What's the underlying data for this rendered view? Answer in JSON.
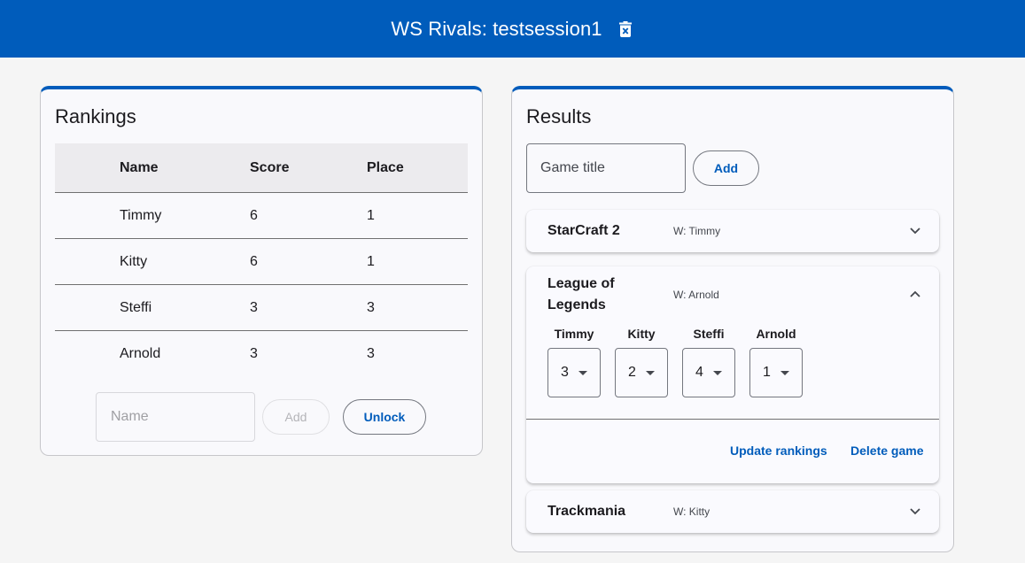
{
  "header": {
    "title": "WS Rivals: testsession1"
  },
  "rankings": {
    "title": "Rankings",
    "columns": [
      "Name",
      "Score",
      "Place"
    ],
    "rows": [
      {
        "name": "Timmy",
        "score": "6",
        "place": "1"
      },
      {
        "name": "Kitty",
        "score": "6",
        "place": "1"
      },
      {
        "name": "Steffi",
        "score": "3",
        "place": "3"
      },
      {
        "name": "Arnold",
        "score": "3",
        "place": "3"
      }
    ],
    "name_placeholder": "Name",
    "add_label": "Add",
    "unlock_label": "Unlock"
  },
  "results": {
    "title": "Results",
    "game_title_placeholder": "Game title",
    "add_label": "Add",
    "games": [
      {
        "title": "StarCraft 2",
        "winner": "W: Timmy",
        "expanded": false
      },
      {
        "title": "League of Legends",
        "winner": "W: Arnold",
        "expanded": true,
        "players": [
          {
            "name": "Timmy",
            "rank": "3"
          },
          {
            "name": "Kitty",
            "rank": "2"
          },
          {
            "name": "Steffi",
            "rank": "4"
          },
          {
            "name": "Arnold",
            "rank": "1"
          }
        ],
        "update_label": "Update rankings",
        "delete_label": "Delete game"
      },
      {
        "title": "Trackmania",
        "winner": "W: Kitty",
        "expanded": false
      }
    ]
  },
  "colors": {
    "primary": "#005cbb",
    "background": "#f5f5f5",
    "surface": "#f9f9fc"
  },
  "icons": {
    "header_action": "delete-session-icon",
    "collapsed": "chevron-down-icon",
    "expanded": "chevron-up-icon",
    "select": "dropdown-arrow-icon"
  }
}
